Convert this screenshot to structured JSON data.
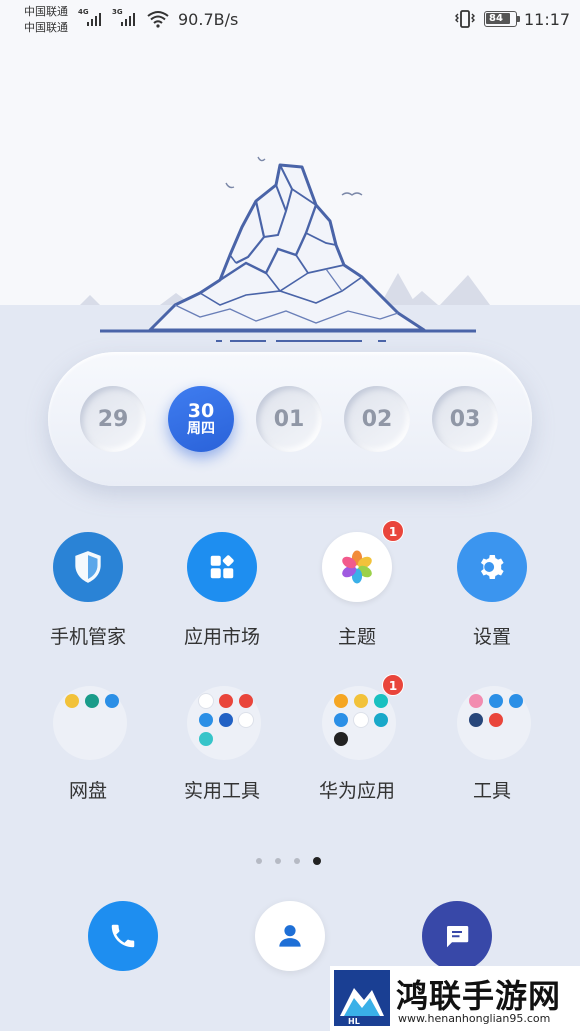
{
  "status_bar": {
    "carrier1": "中国联通",
    "carrier2": "中国联通",
    "net1": "4G",
    "net2": "3G",
    "speed": "90.7B/s",
    "battery": "84",
    "time": "11:17"
  },
  "calendar": {
    "days": [
      {
        "day": "29",
        "weekday": ""
      },
      {
        "day": "30",
        "weekday": "周四"
      },
      {
        "day": "01",
        "weekday": ""
      },
      {
        "day": "02",
        "weekday": ""
      },
      {
        "day": "03",
        "weekday": ""
      }
    ],
    "selected_index": 1,
    "accent": "#2f6ee3"
  },
  "apps": [
    {
      "label": "手机管家",
      "icon": "shield-icon",
      "color": "#2a83d6",
      "badge": ""
    },
    {
      "label": "应用市场",
      "icon": "app-store-icon",
      "color": "#1e8ef0",
      "badge": ""
    },
    {
      "label": "主题",
      "icon": "theme-flower-icon",
      "color": "#ffffff",
      "badge": "1"
    },
    {
      "label": "设置",
      "icon": "gear-icon",
      "color": "#3b95ef",
      "badge": ""
    }
  ],
  "folders": [
    {
      "label": "网盘",
      "badge": "",
      "mini_icons": [
        "#f2c23a",
        "#1a9c8a",
        "#2b8fe6"
      ]
    },
    {
      "label": "实用工具",
      "badge": "",
      "mini_icons": [
        "#ffffff",
        "#e9453b",
        "#e9453b",
        "#2b8fe6",
        "#2161c4",
        "#ffffff",
        "#36c4c9"
      ]
    },
    {
      "label": "华为应用",
      "badge": "1",
      "mini_icons": [
        "#f5a623",
        "#f2c23a",
        "#18c0c0",
        "#2b8fe6",
        "#ffffff",
        "#18a8c9",
        "#222222"
      ]
    },
    {
      "label": "工具",
      "badge": "",
      "mini_icons": [
        "#f28cb0",
        "#2b8fe6",
        "#2b8fe6",
        "#27467a",
        "#e9453b"
      ]
    }
  ],
  "page_indicator": {
    "count": 4,
    "current": 3
  },
  "dock": [
    {
      "name": "phone",
      "icon": "phone-icon",
      "color": "#1e8ef0"
    },
    {
      "name": "contacts",
      "icon": "contact-icon",
      "color": "#ffffff"
    },
    {
      "name": "messages",
      "icon": "message-icon",
      "color": "#3848a8"
    }
  ],
  "watermark": {
    "title": "鸿联手游网",
    "url": "www.henanhonglian95.com"
  }
}
